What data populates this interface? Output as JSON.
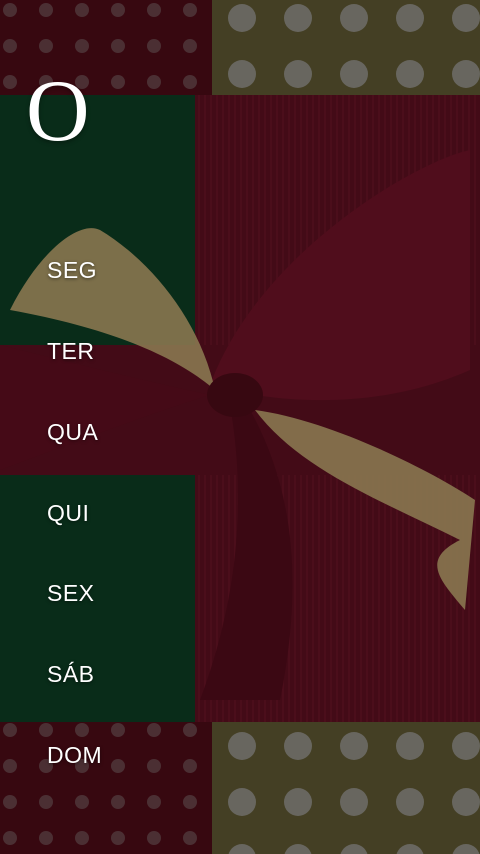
{
  "logo": {
    "text": "O"
  },
  "menu": {
    "items": [
      {
        "label": "SEG"
      },
      {
        "label": "TER"
      },
      {
        "label": "QUA"
      },
      {
        "label": "QUI"
      },
      {
        "label": "SEX"
      },
      {
        "label": "SÁB"
      },
      {
        "label": "DOM"
      }
    ]
  },
  "colors": {
    "green": "#0d3b22",
    "red": "#5a0f1f",
    "ribbon": "#6b1226",
    "gold": "#b79e6a",
    "text": "#ffffff"
  }
}
